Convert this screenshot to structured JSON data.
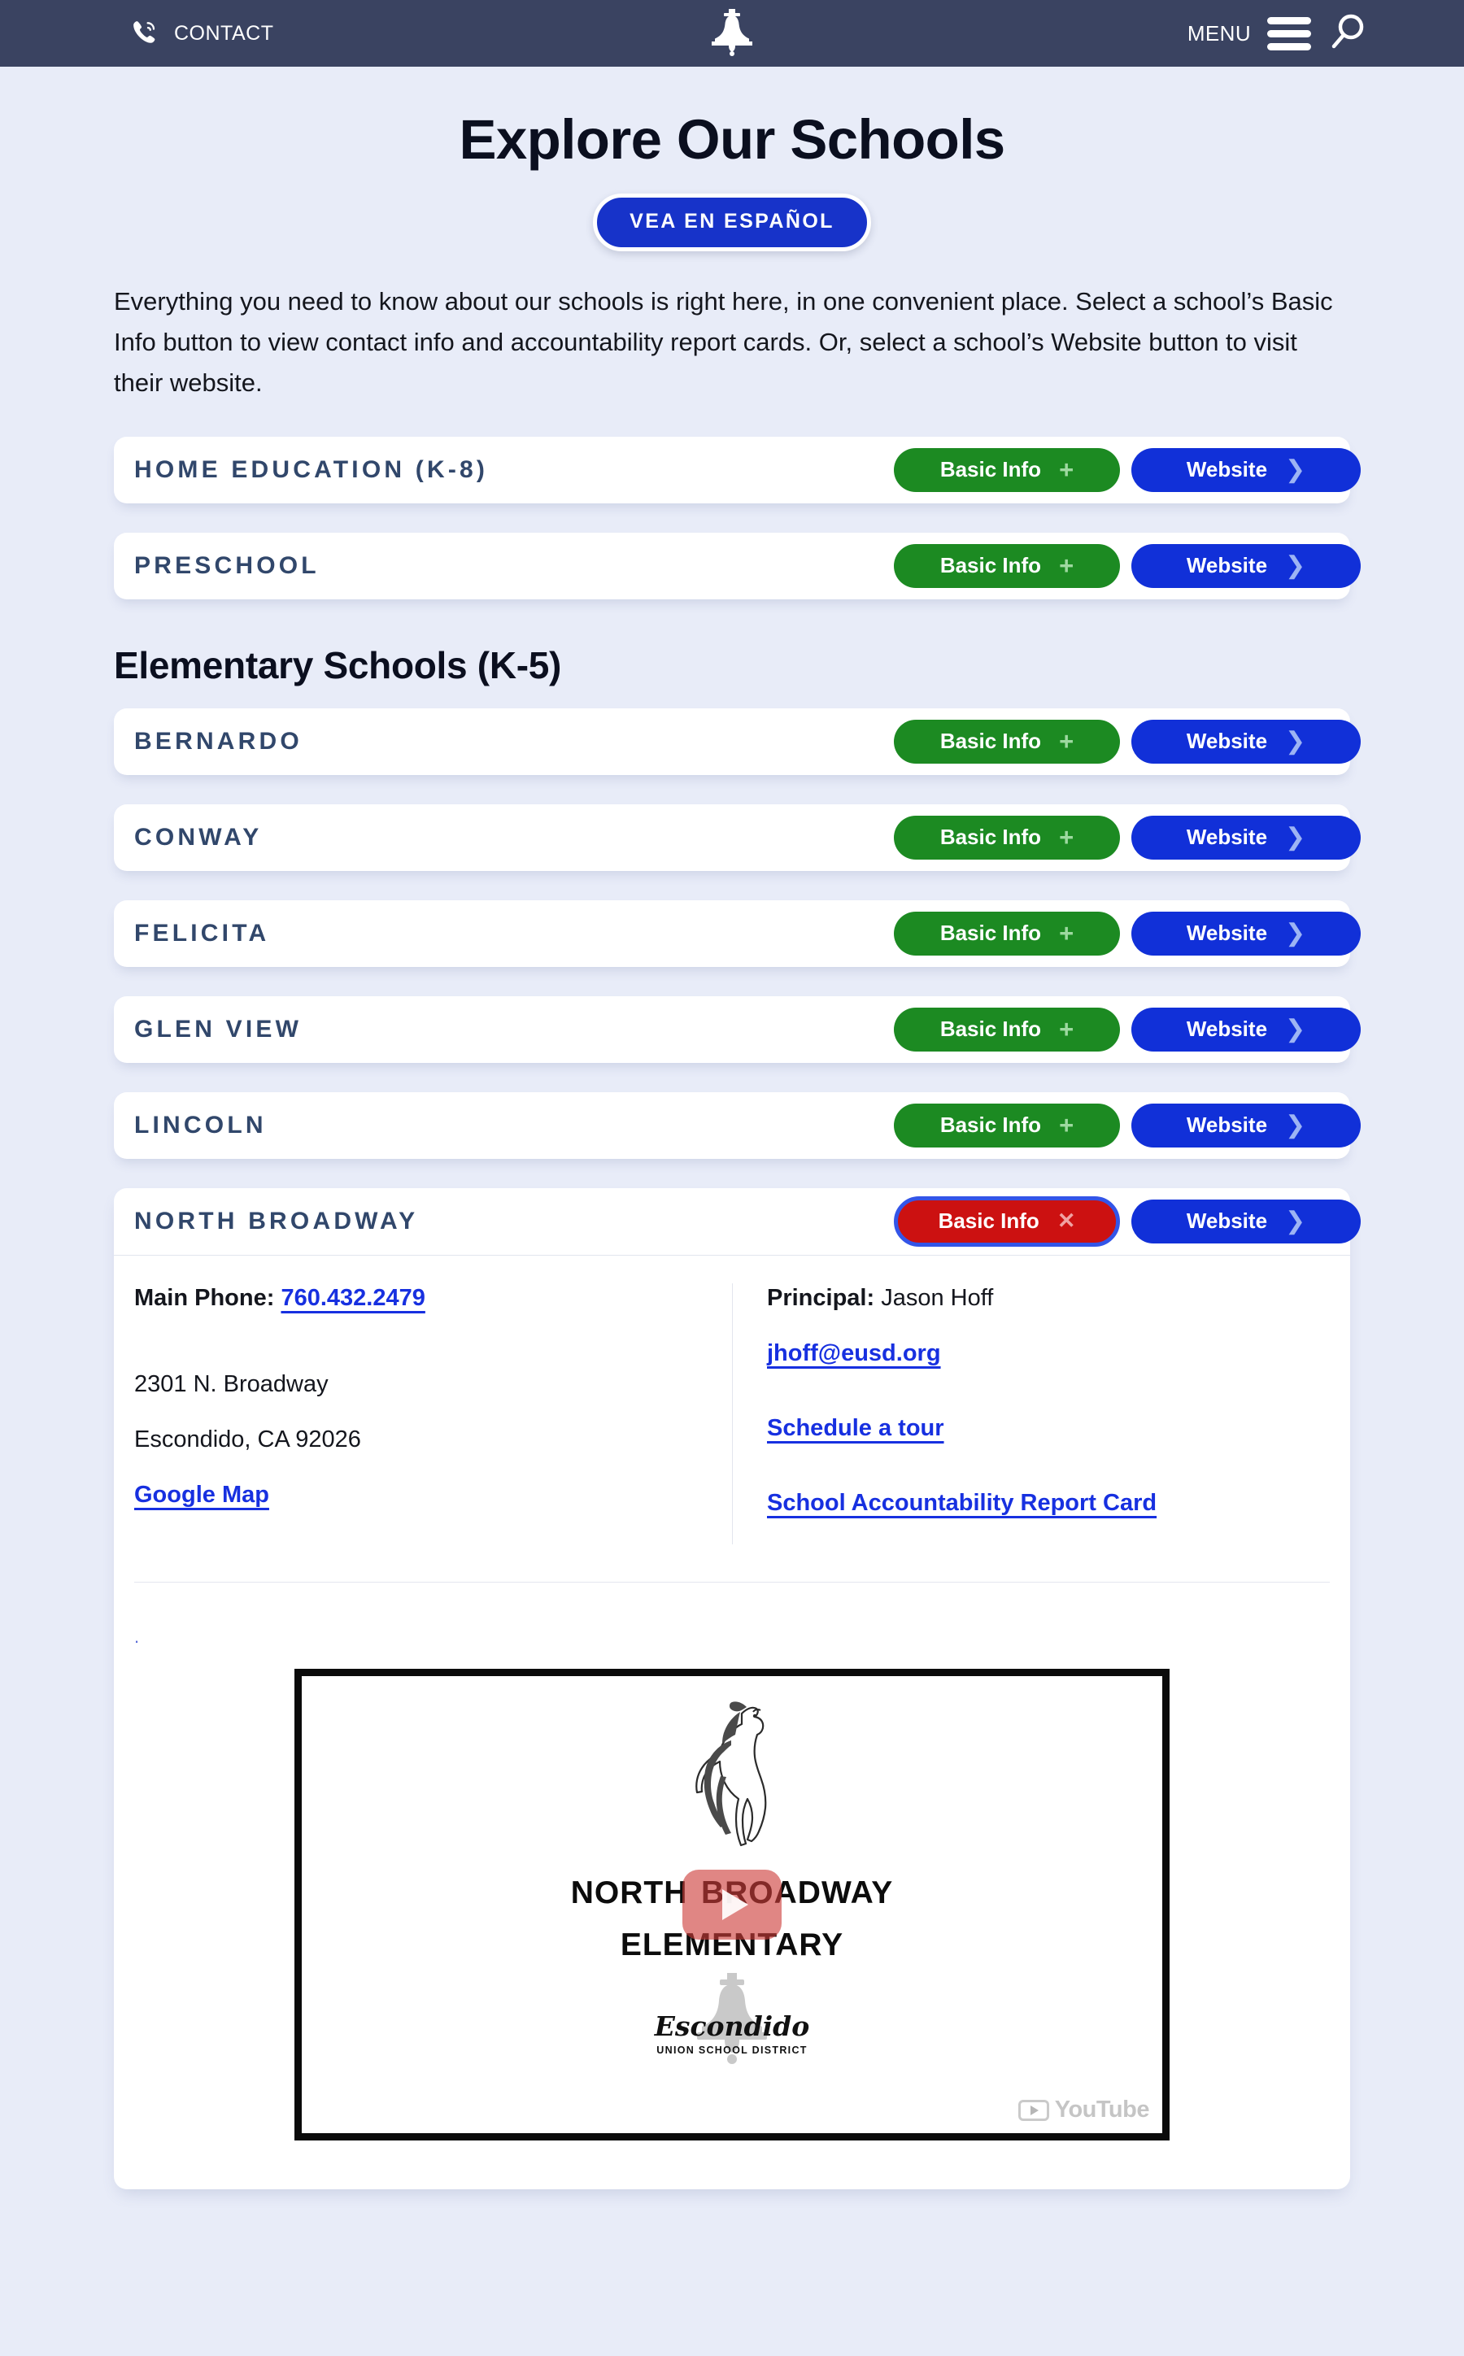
{
  "topbar": {
    "contact_label": "CONTACT",
    "menu_label": "MENU",
    "phone_icon": "phone-icon",
    "bell_logo": "bell-logo-icon",
    "hamburger_icon": "hamburger-icon",
    "search_icon": "search-icon",
    "bg_color": "#3a4361"
  },
  "hero": {
    "title": "Explore Our Schools",
    "language_button": "VEA EN ESPAÑOL",
    "language_button_color": "#1733c9",
    "intro": "Everything you need to know about our schools is right here, in one convenient place. Select a school’s Basic Info button to view contact info and accountability report cards. Or, select a school’s Website button to visit their website."
  },
  "buttons": {
    "basic_info": "Basic Info",
    "website": "Website",
    "plus_glyph": "+",
    "close_glyph": "✕",
    "chevron_glyph": "❯",
    "basic_color": "#1c8a22",
    "basic_active_color": "#cc1111",
    "website_color": "#1130d8",
    "focus_ring_color": "#3355e8"
  },
  "top_programs": [
    {
      "name": "HOME EDUCATION (K-8)"
    },
    {
      "name": "PRESCHOOL"
    }
  ],
  "sections": [
    {
      "heading": "Elementary Schools (K-5)",
      "schools": [
        {
          "name": "BERNARDO"
        },
        {
          "name": "CONWAY"
        },
        {
          "name": "FELICITA"
        },
        {
          "name": "GLEN VIEW"
        },
        {
          "name": "LINCOLN"
        }
      ]
    }
  ],
  "expanded_school": {
    "name": "NORTH BROADWAY",
    "expanded": true,
    "details": {
      "phone_label": "Main Phone:",
      "phone_value": "760.432.2479",
      "address_line1": "2301 N. Broadway",
      "address_line2": "Escondido, CA 92026",
      "map_link": "Google Map",
      "principal_label": "Principal:",
      "principal_value": "Jason Hoff",
      "email": "jhoff@eusd.org",
      "tour_link": "Schedule a tour",
      "sarc_link": "School Accountability Report Card"
    },
    "video": {
      "title_line1": "North Broadway",
      "title_line2": "Elementary",
      "district_script": "Escondido",
      "district_sub": "UNION SCHOOL DISTRICT",
      "provider": "YouTube",
      "mascot": "rearing-horse-mascot",
      "play_label": "Play video"
    }
  }
}
